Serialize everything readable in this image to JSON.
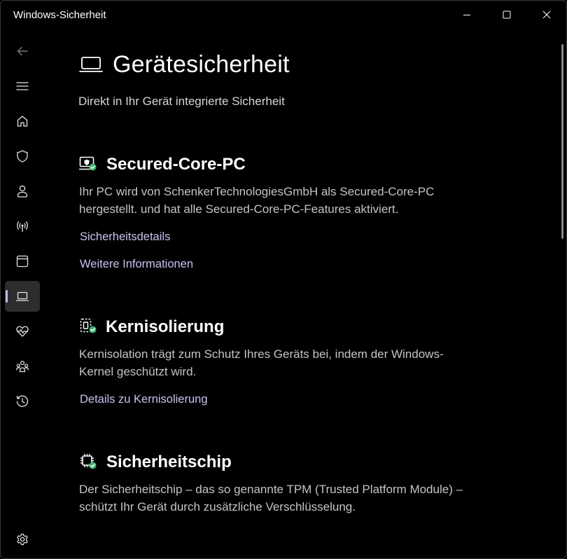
{
  "window": {
    "title": "Windows-Sicherheit"
  },
  "nav": {
    "items": [
      {
        "icon": "back-arrow-icon"
      },
      {
        "icon": "hamburger-menu-icon"
      },
      {
        "icon": "home-icon"
      },
      {
        "icon": "shield-icon"
      },
      {
        "icon": "person-icon"
      },
      {
        "icon": "wireless-antenna-icon"
      },
      {
        "icon": "app-browser-icon"
      },
      {
        "icon": "laptop-icon",
        "active": true
      },
      {
        "icon": "heartbeat-icon"
      },
      {
        "icon": "family-icon"
      },
      {
        "icon": "history-icon"
      },
      {
        "icon": "settings-gear-icon"
      }
    ],
    "accent_color": "#c7b8f5"
  },
  "page": {
    "title": "Gerätesicherheit",
    "subtitle": "Direkt in Ihr Gerät integrierte Sicherheit"
  },
  "sections": [
    {
      "title": "Secured-Core-PC",
      "icon": "secured-core-pc-icon",
      "description_lines": [
        "Ihr PC wird von SchenkerTechnologiesGmbH als Secured-Core-PC",
        "hergestellt. und hat alle Secured-Core-PC-Features aktiviert."
      ],
      "links": [
        "Sicherheitsdetails",
        "Weitere Informationen"
      ]
    },
    {
      "title": "Kernisolierung",
      "icon": "core-isolation-icon",
      "description_lines": [
        "Kernisolation trägt zum Schutz Ihres Geräts bei, indem der Windows-",
        "Kernel geschützt wird."
      ],
      "links": [
        "Details zu Kernisolierung"
      ]
    },
    {
      "title": "Sicherheitschip",
      "icon": "security-chip-icon",
      "description_lines": [
        "Der Sicherheitschip – das so genannte TPM (Trusted Platform Module) –",
        "schützt Ihr Gerät durch zusätzliche Verschlüsselung."
      ],
      "links": []
    }
  ],
  "colors": {
    "background": "#000000",
    "link": "#c9c2f0",
    "status_ok": "#3cb371"
  }
}
